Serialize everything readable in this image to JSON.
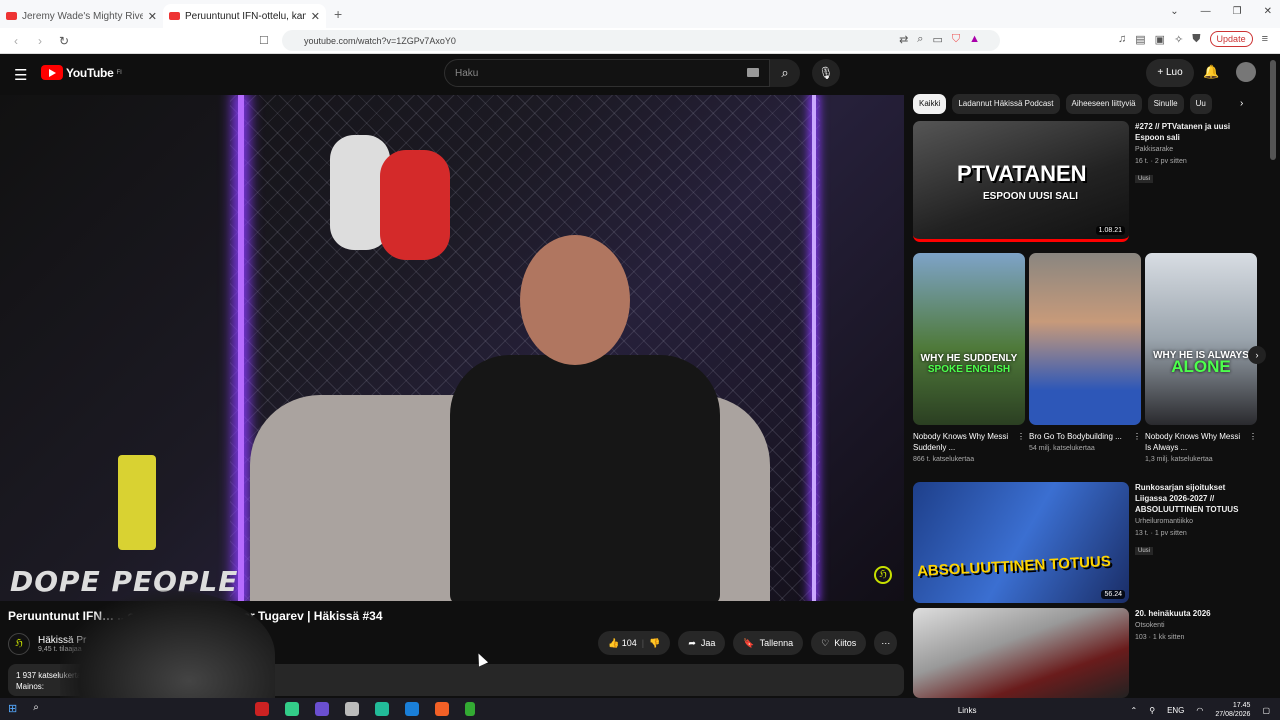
{
  "browser": {
    "tabs": [
      {
        "label": "Jeremy Wade's Mighty Rivers - Full E"
      },
      {
        "label": "Peruuntunut IFN-ottelu, kamp"
      }
    ],
    "url": "youtube.com/watch?v=1ZGPv7AxoY0",
    "update_label": "Update"
  },
  "header": {
    "logo": "YouTube",
    "region": "FI",
    "search_placeholder": "Haku",
    "create_label": "Luo"
  },
  "video": {
    "overlay_text": "DOPE PEOPLE",
    "title": "Peruuntunut IFN… ...o tie UFC:hen ft. Omar Tugarev | Häkissä #34",
    "channel": "Häkissä Pr",
    "subs": "9,45 t. tilaajaa",
    "likes": "104",
    "share": "Jaa",
    "save": "Tallenna",
    "thanks": "Kiitos",
    "desc_line1": "1 937 katselukertaa",
    "desc_line2": "Mainos:"
  },
  "chips": [
    "Kaikki",
    "Ladannut Häkissä Podcast",
    "Aiheeseen liittyviä",
    "Sinulle",
    "Uu"
  ],
  "recs": [
    {
      "title": "#272 // PTVatanen ja uusi Espoon sali",
      "channel": "Pakkisarake",
      "meta": "16 t. · 2 pv sitten",
      "badge": "Uusi",
      "duration": "1.08.21",
      "thumb_text": "PTVATANEN",
      "thumb_sub": "ESPOON UUSI SALI"
    },
    {
      "title": "Runkosarjan sijoitukset Liigassa 2026-2027 // ABSOLUUTTINEN TOTUUS",
      "channel": "Urheiluromantiikko",
      "meta": "13 t. · 1 pv sitten",
      "badge": "Uusi",
      "duration": "56.24",
      "thumb_text": "ABSOLUUTTINEN TOTUUS"
    },
    {
      "title": "20. heinäkuuta 2026",
      "channel": "Otsokenti",
      "meta": "103 · 1 kk sitten"
    }
  ],
  "shorts": [
    {
      "title": "Nobody Knows Why Messi Suddenly ...",
      "views": "866 t. katselukertaa",
      "cap1": "WHY HE SUDDENLY",
      "cap2": "SPOKE ENGLISH"
    },
    {
      "title": "Bro Go To Bodybuilding ...",
      "views": "54 milj. katselukertaa",
      "cap1": "",
      "cap2": ""
    },
    {
      "title": "Nobody Knows Why Messi Is Always ...",
      "views": "1,3 milj. katselukertaa",
      "cap1": "WHY HE IS ALWAYS",
      "cap2": "ALONE"
    }
  ],
  "taskbar": {
    "links": "Links",
    "lang": "ENG",
    "time": "17.45",
    "date": "27/08/2026"
  }
}
